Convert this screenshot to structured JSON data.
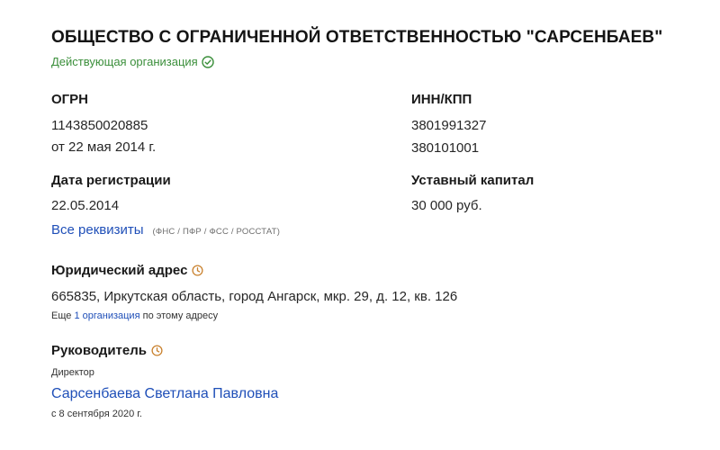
{
  "company": {
    "name": "ОБЩЕСТВО С ОГРАНИЧЕННОЙ ОТВЕТСТВЕННОСТЬЮ \"САРСЕНБАЕВ\"",
    "status": "Действующая организация"
  },
  "ogrn": {
    "label": "ОГРН",
    "value": "1143850020885",
    "date": "от 22 мая 2014 г."
  },
  "inn_kpp": {
    "label": "ИНН/КПП",
    "inn": "3801991327",
    "kpp": "380101001"
  },
  "registration": {
    "label": "Дата регистрации",
    "value": "22.05.2014"
  },
  "capital": {
    "label": "Уставный капитал",
    "value": "30 000 руб."
  },
  "requisites": {
    "link_label": "Все реквизиты",
    "note": "(ФНС / ПФР / ФСС / РОССТАТ)"
  },
  "address": {
    "label": "Юридический адрес",
    "value": "665835, Иркутская область, город Ангарск, мкр. 29, д. 12, кв. 126",
    "more_prefix": "Еще",
    "more_link": "1 организация",
    "more_suffix": "по этому адресу"
  },
  "manager": {
    "label": "Руководитель",
    "position": "Директор",
    "name": "Сарсенбаева Светлана Павловна",
    "since": "с 8 сентября 2020 г."
  },
  "icons": {
    "status": "check-circle-icon",
    "history": "clock-icon"
  },
  "colors": {
    "status_green": "#3b8f3b",
    "link_blue": "#1f4fb8",
    "clock_orange": "#c9822f"
  }
}
